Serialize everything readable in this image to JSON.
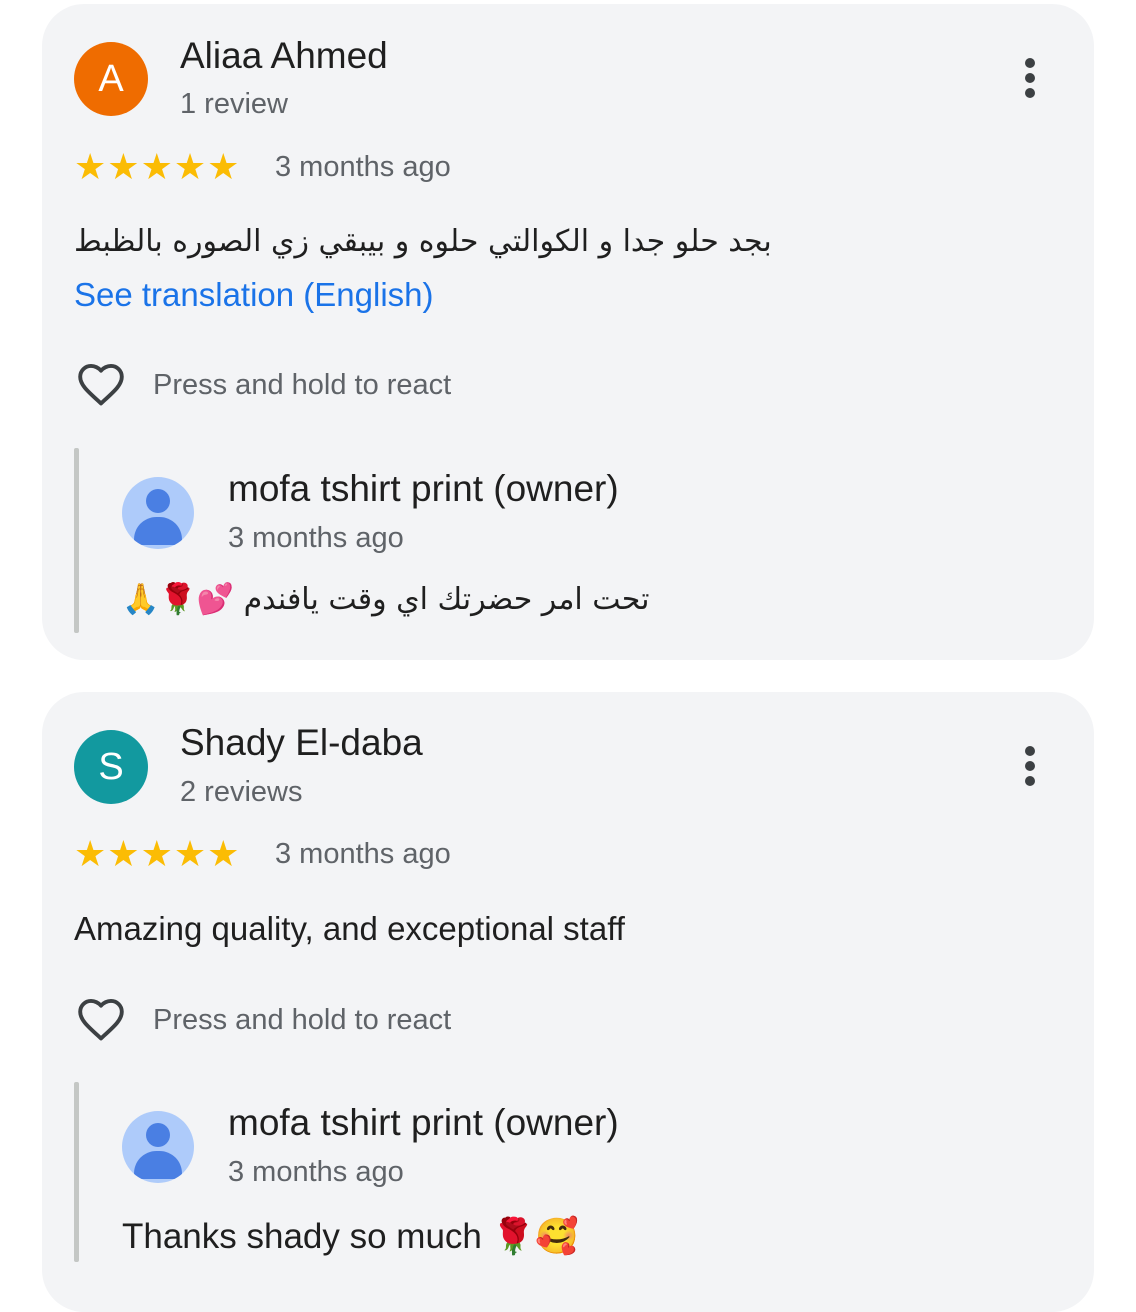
{
  "reviews": [
    {
      "avatar_letter": "A",
      "avatar_color": "#ef6c00",
      "name": "Aliaa Ahmed",
      "review_count": "1 review",
      "stars": "★★★★★",
      "rating": 5,
      "time": "3 months ago",
      "text": "بجد حلو جدا و الكوالتي حلوه و بيبقي زي الصوره بالظبط",
      "translate_link": "See translation (English)",
      "react_label": "Press and hold to react",
      "reply": {
        "owner_name": "mofa tshirt print (owner)",
        "time": "3 months ago",
        "text": "تحت امر حضرتك اي وقت يافندم 💕🌹🙏"
      }
    },
    {
      "avatar_letter": "S",
      "avatar_color": "#12999f",
      "name": "Shady El-daba",
      "review_count": "2 reviews",
      "stars": "★★★★★",
      "rating": 5,
      "time": "3 months ago",
      "text": "Amazing quality, and exceptional staff",
      "react_label": "Press and hold to react",
      "reply": {
        "owner_name": "mofa tshirt print (owner)",
        "time": "3 months ago",
        "text": "Thanks shady so much 🌹🥰"
      }
    }
  ],
  "icons": {
    "menu": "more-vert-icon",
    "react": "heart-outline-icon",
    "reply_avatar": "person-icon",
    "star": "star-icon"
  },
  "colors": {
    "card_bg": "#f3f4f6",
    "star": "#fbbc04",
    "link": "#1a73e8",
    "reply_bar": "#c4c7c5"
  }
}
